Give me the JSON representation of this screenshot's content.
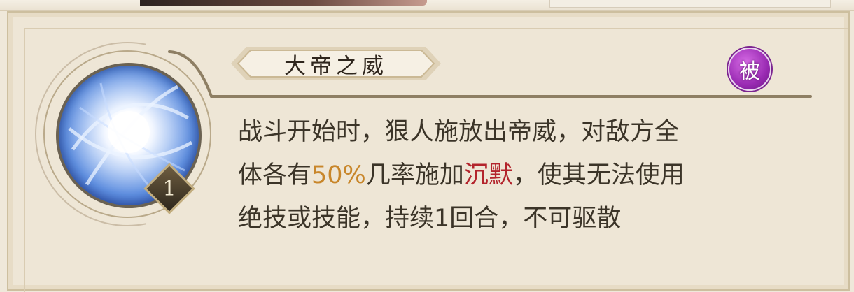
{
  "skill": {
    "name": "大帝之威",
    "level": "1",
    "type_badge": "被",
    "icon": "blue-energy-orb-icon"
  },
  "description": {
    "line1": "战斗开始时，狠人施放出帝威，对敌方全",
    "line2_part1": "体各有",
    "line2_chance": "50%",
    "line2_part2": "几率施加",
    "line2_effect": "沉默",
    "line2_part3": "，使其无法使用",
    "line3": "绝技或技能，持续1回合，不可驱散"
  },
  "colors": {
    "text": "#3b3428",
    "chance_highlight": "#c8862a",
    "effect_highlight": "#b3242c",
    "passive_badge": "#9a2bb3"
  }
}
